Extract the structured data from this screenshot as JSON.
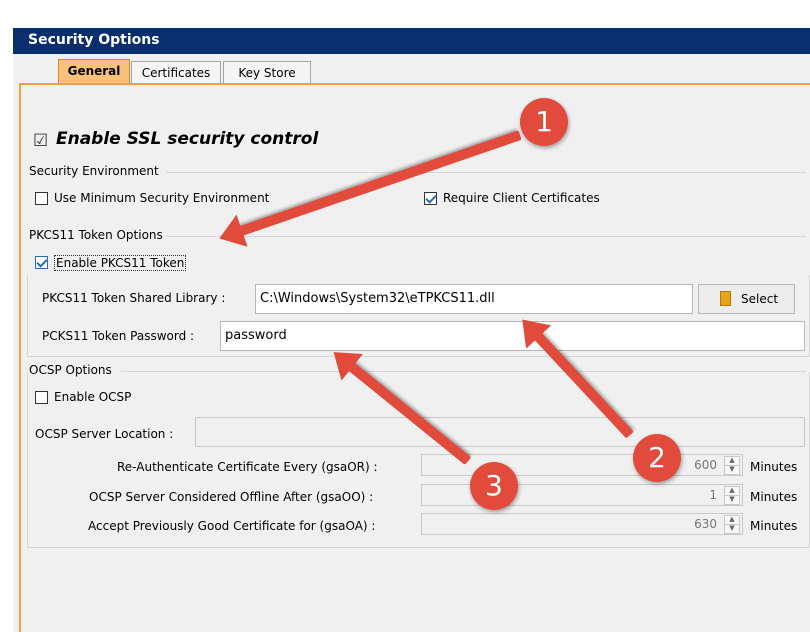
{
  "window": {
    "title": "Security Options"
  },
  "tabs": [
    {
      "label": "General",
      "active": true
    },
    {
      "label": "Certificates",
      "active": false
    },
    {
      "label": "Key Store",
      "active": false
    }
  ],
  "general": {
    "enable_ssl": {
      "label": "Enable SSL security control",
      "checked": true
    },
    "security_env": {
      "group_label": "Security Environment",
      "use_min_label": "Use Minimum Security Environment",
      "use_min_checked": false,
      "require_client_label": "Require Client Certificates",
      "require_client_checked": true
    },
    "pkcs11": {
      "group_label": "PKCS11 Token Options",
      "enable_label": "Enable PKCS11 Token",
      "enable_checked": true,
      "library_label": "PKCS11 Token Shared Library :",
      "library_value": "C:\\Windows\\System32\\eTPKCS11.dll",
      "select_label": "Select",
      "password_label": "PCKS11 Token Password :",
      "password_value": "password"
    },
    "ocsp": {
      "group_label": "OCSP Options",
      "enable_label": "Enable OCSP",
      "enable_checked": false,
      "server_location_label": "OCSP Server Location :",
      "server_location_value": "",
      "rows": [
        {
          "label": "Re-Authenticate Certificate Every (gsaOR) :",
          "value": "600",
          "unit": "Minutes"
        },
        {
          "label": "OCSP Server Considered Offline After (gsaOO) :",
          "value": "1",
          "unit": "Minutes"
        },
        {
          "label": "Accept Previously Good Certificate for (gsaOA) :",
          "value": "630",
          "unit": "Minutes"
        }
      ]
    }
  },
  "annotations": {
    "badge1": "1",
    "badge2": "2",
    "badge3": "3"
  },
  "colors": {
    "titlebar": "#0b2f6e",
    "active_tab": "#f9c27a",
    "tab_border": "#f0a04b",
    "annotation": "#e24a3b"
  },
  "icons": {
    "select_button": "folder-icon",
    "checkbox": "checkmark-icon"
  }
}
